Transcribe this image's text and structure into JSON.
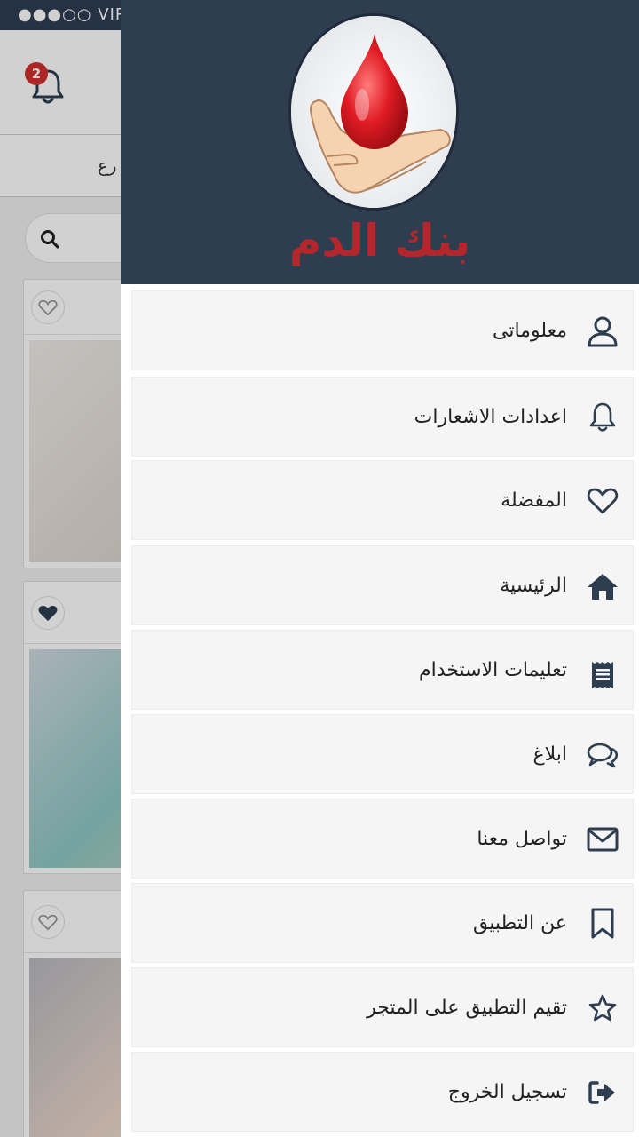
{
  "status_bar": {
    "carrier": "●●●○○ VIRG"
  },
  "header": {
    "notification_count": "2"
  },
  "tabs": {
    "partial_label": "رع"
  },
  "cards": [
    {
      "favorited": false
    },
    {
      "favorited": true
    },
    {
      "favorited": false
    }
  ],
  "drawer": {
    "logo_text": "بنك الدم",
    "items": [
      {
        "label": "معلوماتى",
        "icon": "user-icon"
      },
      {
        "label": "اعدادات الاشعارات",
        "icon": "bell-icon"
      },
      {
        "label": "المفضلة",
        "icon": "heart-icon"
      },
      {
        "label": "الرئيسية",
        "icon": "home-icon"
      },
      {
        "label": "تعليمات الاستخدام",
        "icon": "receipt-icon"
      },
      {
        "label": "ابلاغ",
        "icon": "chat-bubbles-icon"
      },
      {
        "label": "تواصل معنا",
        "icon": "envelope-icon"
      },
      {
        "label": "عن التطبيق",
        "icon": "bookmark-icon"
      },
      {
        "label": "تقيم التطبيق على المتجر",
        "icon": "star-icon"
      },
      {
        "label": "تسجيل الخروج",
        "icon": "sign-out-icon"
      }
    ]
  },
  "colors": {
    "drawer_header_bg": "#2e3d50",
    "brand_red": "#b3262c",
    "badge_red": "#d32f2f",
    "menu_item_bg": "#f5f5f5"
  }
}
